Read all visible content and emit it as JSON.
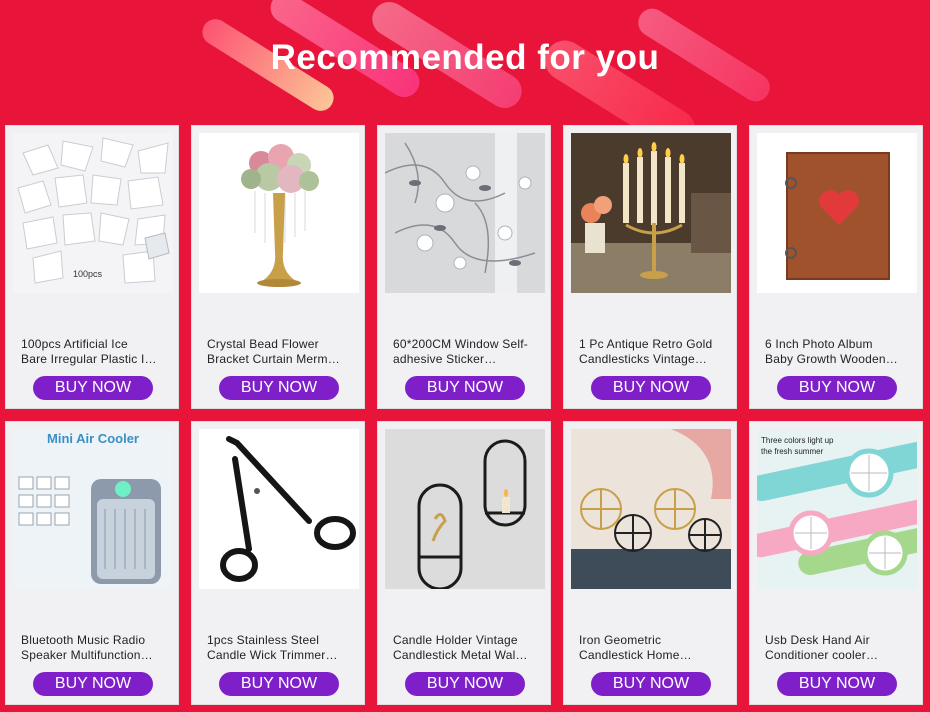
{
  "banner": {
    "title": "Recommended for you"
  },
  "buy_label": "BUY NOW",
  "products": [
    {
      "line1": "100pcs Artificial Ice",
      "line2": "Bare Irregular Plastic I…",
      "image_caption": "100pcs",
      "icon": "ice-cubes"
    },
    {
      "line1": "Crystal Bead Flower",
      "line2": "Bracket Curtain Merm…",
      "icon": "flower-stand"
    },
    {
      "line1": "60*200CM Window Self-",
      "line2": "adhesive Sticker…",
      "icon": "window-sticker"
    },
    {
      "line1": "1 Pc Antique Retro Gold",
      "line2": "Candlesticks Vintage…",
      "icon": "candelabra"
    },
    {
      "line1": "6 Inch Photo Album",
      "line2": "Baby Growth Wooden…",
      "icon": "photo-album"
    },
    {
      "line1": "Bluetooth Music Radio",
      "line2": "Speaker Multifunction…",
      "image_caption": "Mini Air Cooler",
      "icon": "air-cooler"
    },
    {
      "line1": "1pcs Stainless Steel",
      "line2": "Candle Wick Trimmer…",
      "icon": "wick-trimmer"
    },
    {
      "line1": "Candle Holder Vintage",
      "line2": "Candlestick Metal Wal…",
      "icon": "wall-candle-holder"
    },
    {
      "line1": "Iron Geometric",
      "line2": "Candlestick Home…",
      "icon": "geometric-candlestick"
    },
    {
      "line1": "Usb Desk Hand Air",
      "line2": "Conditioner cooler…",
      "image_caption": "Three colors light up the fresh summer",
      "icon": "hand-fan"
    }
  ]
}
